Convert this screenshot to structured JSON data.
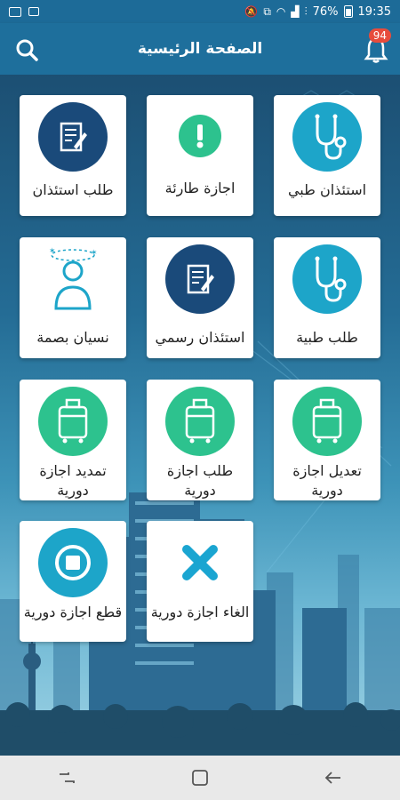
{
  "status_bar": {
    "battery": "76%",
    "time": "19:35"
  },
  "app_bar": {
    "title": "الصفحة الرئيسية",
    "notifications_count": "94"
  },
  "tiles": [
    {
      "label": "استئذان طبي",
      "icon": "stethoscope-icon",
      "color": "#1da5c9"
    },
    {
      "label": "اجازة طارئة",
      "icon": "exclamation-icon",
      "color": "#2dc28e"
    },
    {
      "label": "طلب استئذان",
      "icon": "document-pen-icon",
      "color": "#1a4a7a"
    },
    {
      "label": "طلب طبية",
      "icon": "stethoscope-icon",
      "color": "#1da5c9"
    },
    {
      "label": "استئذان رسمي",
      "icon": "document-pen-icon",
      "color": "#1a4a7a"
    },
    {
      "label": "نسيان بصمة",
      "icon": "confused-person-icon",
      "color": "#ffffff"
    },
    {
      "label": "تعديل اجازة دورية",
      "icon": "suitcase-icon",
      "color": "#2dc28e"
    },
    {
      "label": "طلب اجازة دورية",
      "icon": "suitcase-icon",
      "color": "#2dc28e"
    },
    {
      "label": "تمديد اجازة دورية",
      "icon": "suitcase-icon",
      "color": "#2dc28e"
    },
    {
      "label": "الغاء اجازة دورية",
      "icon": "cross-icon",
      "color": "#1aa5d1"
    },
    {
      "label": "قطع اجازة دورية",
      "icon": "stop-icon",
      "color": "#1da5c9"
    }
  ]
}
